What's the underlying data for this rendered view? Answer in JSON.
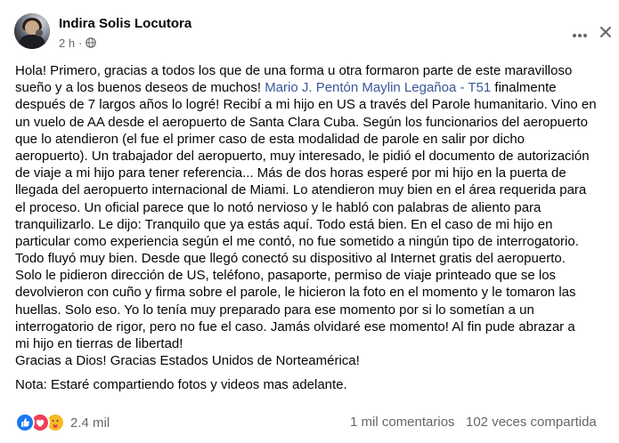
{
  "post": {
    "author": "Indira Solis Locutora",
    "time": "2 h",
    "separator": "·",
    "lines": [
      {
        "pre": "Hola! Primero, gracias a todos los que de una forma u otra formaron parte de este maravilloso",
        "link": "",
        "post": ""
      },
      {
        "pre": "sueño y a los buenos deseos de muchos! ",
        "link": "Mario J. Pentón Maylin Legañoa - T51",
        "post": " finalmente"
      },
      {
        "pre": "después de 7 largos años lo logré! Recibí a mi hijo en US a través del Parole humanitario. Vino en",
        "link": "",
        "post": ""
      },
      {
        "pre": "un vuelo de AA desde el aeropuerto de Santa Clara Cuba. Según los funcionarios del aeropuerto",
        "link": "",
        "post": ""
      },
      {
        "pre": "que lo atendieron (el fue el primer caso de esta modalidad de parole en salir por dicho",
        "link": "",
        "post": ""
      },
      {
        "pre": "aeropuerto). Un trabajador del aeropuerto, muy interesado, le pidió el documento de autorización",
        "link": "",
        "post": ""
      },
      {
        "pre": "de viaje a mi hijo para tener referencia... Más de dos horas esperé por mi hijo en la puerta de",
        "link": "",
        "post": ""
      },
      {
        "pre": "llegada del aeropuerto internacional de Miami. Lo atendieron muy bien en el área requerida para",
        "link": "",
        "post": ""
      },
      {
        "pre": "el proceso. Un oficial parece que lo notó nervioso y le habló con palabras de aliento para",
        "link": "",
        "post": ""
      },
      {
        "pre": "tranquilizarlo. Le dijo: Tranquilo que ya estás aquí. Todo está bien. En el caso de mi hijo en",
        "link": "",
        "post": ""
      },
      {
        "pre": "particular como experiencia según el me contó, no fue sometido a ningún tipo de interrogatorio.",
        "link": "",
        "post": ""
      },
      {
        "pre": "Todo fluyó muy bien. Desde que llegó conectó su dispositivo al Internet gratis del aeropuerto.",
        "link": "",
        "post": ""
      },
      {
        "pre": "Solo le pidieron dirección de US, teléfono, pasaporte, permiso de viaje printeado que se los",
        "link": "",
        "post": ""
      },
      {
        "pre": "devolvieron con cuño y firma sobre el parole, le hicieron la foto en el momento y le tomaron las",
        "link": "",
        "post": ""
      },
      {
        "pre": "huellas. Solo eso. Yo lo tenía muy preparado para ese momento por si lo sometían a un",
        "link": "",
        "post": ""
      },
      {
        "pre": "interrogatorio de rigor, pero no fue el caso. Jamás olvidaré ese momento! Al fin pude abrazar a",
        "link": "",
        "post": ""
      },
      {
        "pre": "mi hijo en tierras de libertad!",
        "link": "",
        "post": ""
      },
      {
        "pre": "Gracias a Dios! Gracias Estados Unidos de Norteamérica!",
        "link": "",
        "post": ""
      }
    ],
    "note": "Nota: Estaré compartiendo fotos y videos mas adelante."
  },
  "footer": {
    "reaction_count": "2.4 mil",
    "comments": "1 mil comentarios",
    "shares": "102 veces compartida"
  },
  "colors": {
    "link": "#385898",
    "muted": "#65676b",
    "like": "#1877f2",
    "love": "#f33e58",
    "care": "#f7b928"
  },
  "icons": [
    "globe-icon",
    "more-icon",
    "close-icon",
    "like-icon",
    "love-icon",
    "care-icon"
  ]
}
